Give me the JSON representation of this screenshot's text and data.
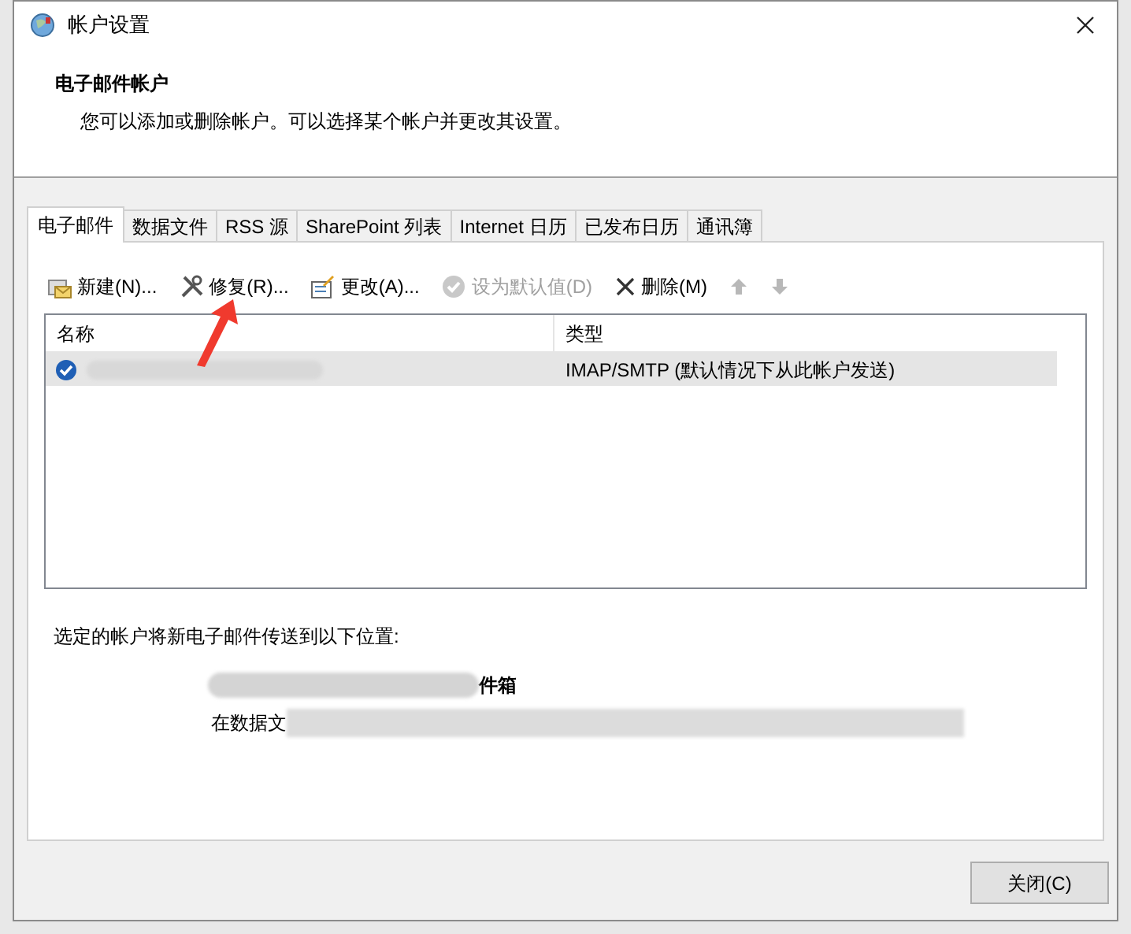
{
  "window": {
    "title": "帐户设置"
  },
  "header": {
    "title": "电子邮件帐户",
    "description": "您可以添加或删除帐户。可以选择某个帐户并更改其设置。"
  },
  "tabs": [
    {
      "label": "电子邮件",
      "selected": true
    },
    {
      "label": "数据文件",
      "selected": false
    },
    {
      "label": "RSS 源",
      "selected": false
    },
    {
      "label": "SharePoint 列表",
      "selected": false
    },
    {
      "label": "Internet 日历",
      "selected": false
    },
    {
      "label": "已发布日历",
      "selected": false
    },
    {
      "label": "通讯簿",
      "selected": false
    }
  ],
  "toolbar": [
    {
      "kind": "new",
      "label": "新建(N)...",
      "disabled": false
    },
    {
      "kind": "repair",
      "label": "修复(R)...",
      "disabled": false
    },
    {
      "kind": "change",
      "label": "更改(A)...",
      "disabled": false
    },
    {
      "kind": "default",
      "label": "设为默认值(D)",
      "disabled": true
    },
    {
      "kind": "delete",
      "label": "删除(M)",
      "disabled": false
    },
    {
      "kind": "up",
      "disabled": true
    },
    {
      "kind": "down",
      "disabled": true
    }
  ],
  "accounts": {
    "columns": [
      "名称",
      "类型"
    ],
    "rows": [
      {
        "type": "IMAP/SMTP (默认情况下从此帐户发送)",
        "selected": true,
        "default": true
      }
    ]
  },
  "delivery": {
    "label": "选定的帐户将新电子邮件传送到以下位置:",
    "folder": "件箱",
    "data_file": "在数据文"
  },
  "buttons": [
    {
      "label": "关闭(C)"
    }
  ]
}
